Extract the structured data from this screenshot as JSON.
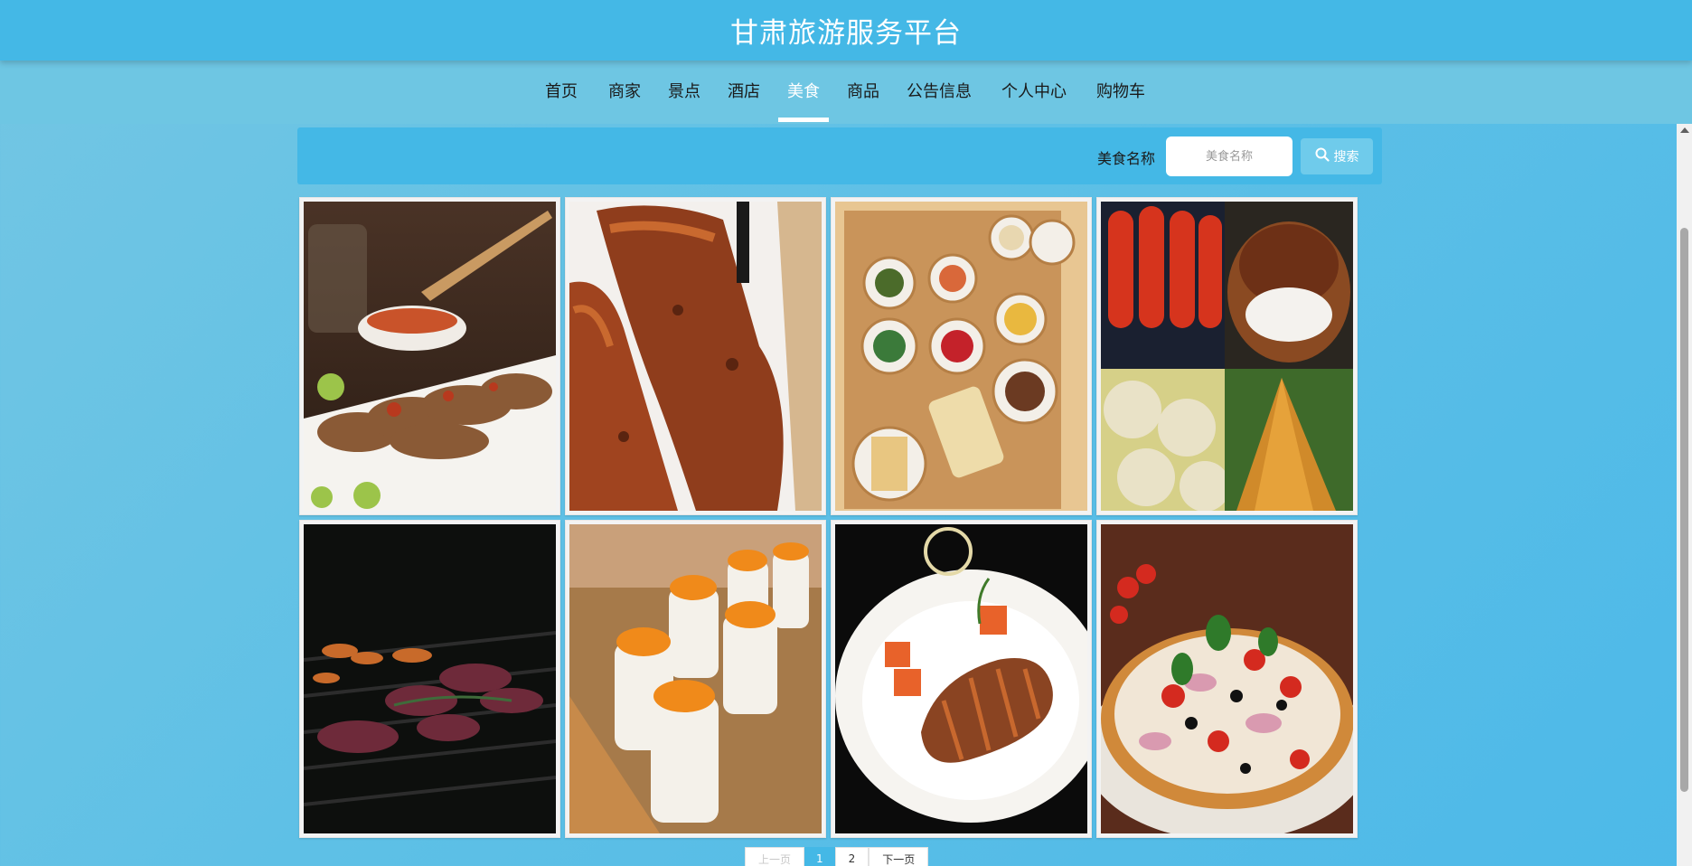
{
  "header": {
    "title": "甘肃旅游服务平台"
  },
  "nav": {
    "items": [
      {
        "label": "首页",
        "active": false
      },
      {
        "label": "商家",
        "active": false
      },
      {
        "label": "景点",
        "active": false
      },
      {
        "label": "酒店",
        "active": false
      },
      {
        "label": "美食",
        "active": true
      },
      {
        "label": "商品",
        "active": false
      },
      {
        "label": "公告信息",
        "active": false
      },
      {
        "label": "个人中心",
        "active": false
      },
      {
        "label": "购物车",
        "active": false
      }
    ]
  },
  "search": {
    "label": "美食名称",
    "placeholder": "美食名称",
    "value": "",
    "button_label": "搜索",
    "button_icon": "search-icon"
  },
  "foods": [
    {
      "image": "grilled-meat-with-sauce"
    },
    {
      "image": "barbecued-pork"
    },
    {
      "image": "bento-box-dishes"
    },
    {
      "image": "street-food-collage"
    },
    {
      "image": "grilled-steak-slices"
    },
    {
      "image": "sushi-rolls-with-roe"
    },
    {
      "image": "plated-meat-roll"
    },
    {
      "image": "pizza"
    }
  ],
  "pagination": {
    "prev_label": "上一页",
    "pages": [
      "1",
      "2"
    ],
    "current": "1",
    "next_label": "下一页"
  },
  "colors": {
    "header": "#44b8e6",
    "nav": "#6ec6e3",
    "active_nav": "#ffffff",
    "page_background": "#5ec0e6"
  }
}
